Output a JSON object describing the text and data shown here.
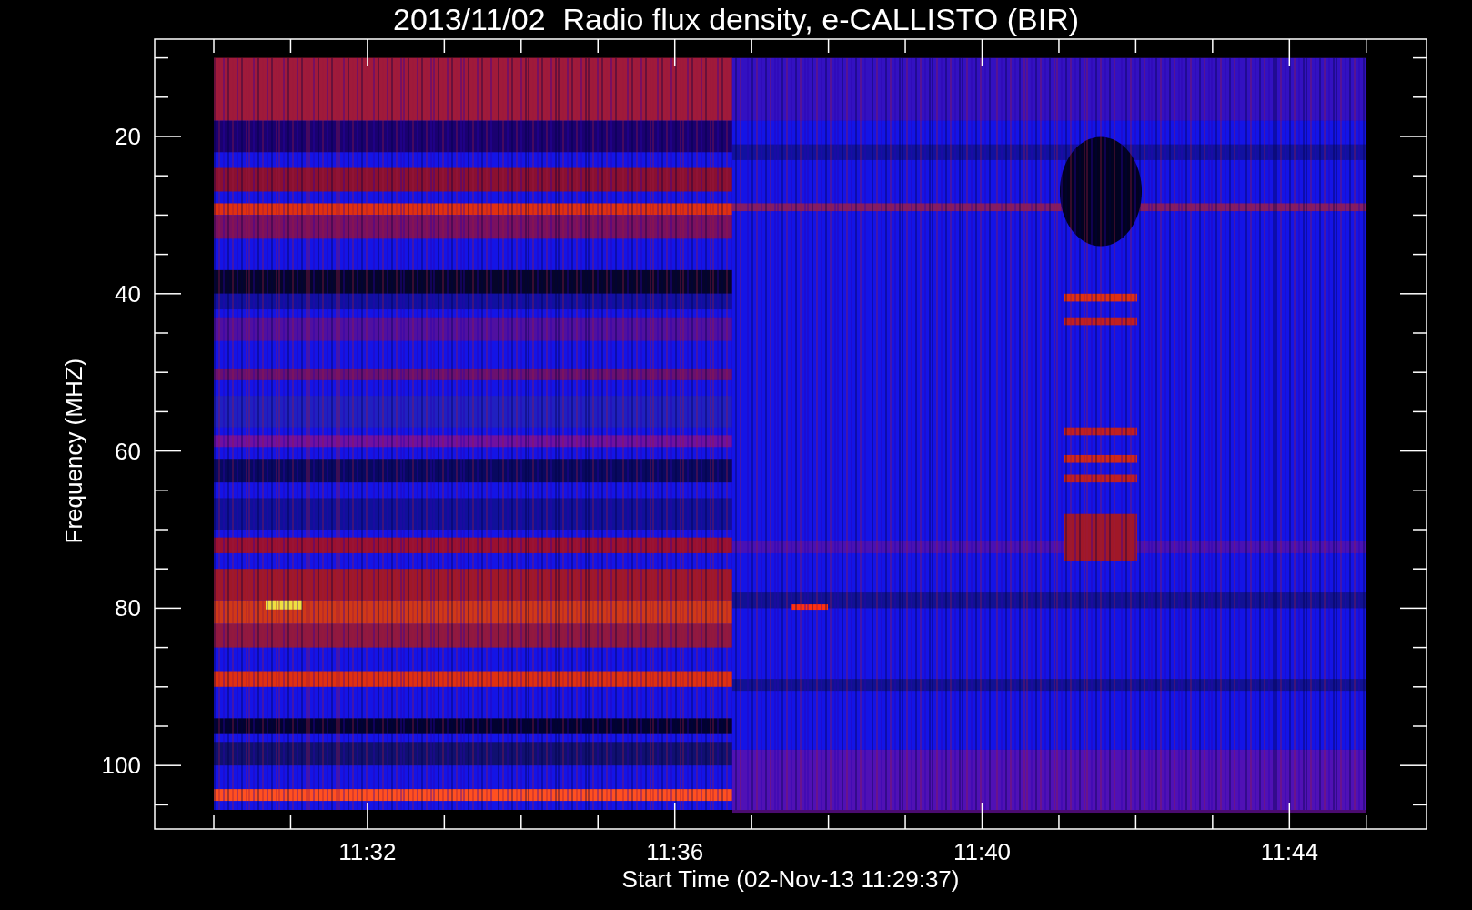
{
  "title": "2013/11/02  Radio flux density, e-CALLISTO (BIR)",
  "y_axis": {
    "label": "Frequency (MHZ)",
    "ticks": [
      "20",
      "40",
      "60",
      "80",
      "100"
    ]
  },
  "x_axis": {
    "label": "Start Time (02-Nov-13 11:29:37)",
    "ticks": [
      "11:32",
      "11:36",
      "11:40",
      "11:44"
    ]
  }
}
